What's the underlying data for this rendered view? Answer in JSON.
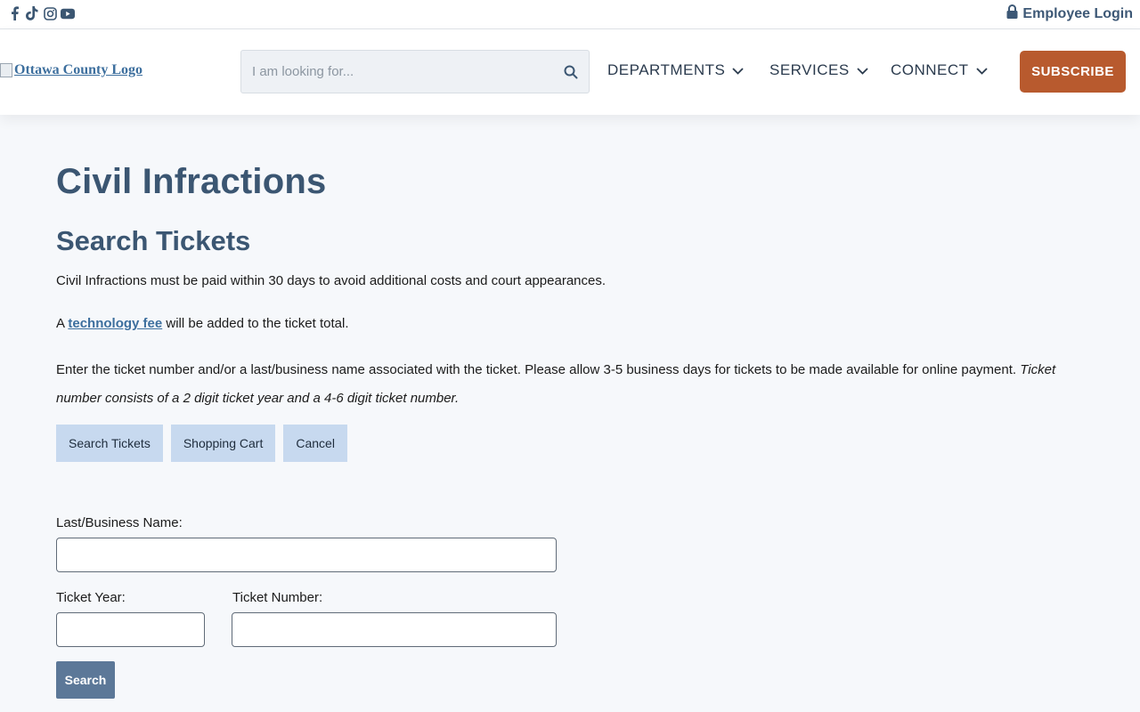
{
  "topbar": {
    "social": [
      {
        "name": "facebook-icon"
      },
      {
        "name": "tiktok-icon"
      },
      {
        "name": "instagram-icon"
      },
      {
        "name": "youtube-icon"
      }
    ],
    "employee_login": "Employee Login"
  },
  "header": {
    "logo_alt": "Ottawa County Logo",
    "search_placeholder": "I am looking for...",
    "nav": [
      {
        "label": "DEPARTMENTS"
      },
      {
        "label": "SERVICES"
      },
      {
        "label": "CONNECT"
      }
    ],
    "subscribe_label": "SUBSCRIBE"
  },
  "main": {
    "title": "Civil Infractions",
    "subtitle": "Search Tickets",
    "para1": "Civil Infractions must be paid within 30 days to avoid additional costs and court appearances.",
    "para2_before": "A ",
    "para2_link": "technology fee",
    "para2_after": " will be added to the ticket total.",
    "para3_text": "Enter the ticket number and/or a last/business name associated with the ticket. Please allow 3-5 business days for tickets to be made available for online payment. ",
    "para3_italic": "Ticket number consists of a 2 digit ticket year and a 4-6 digit ticket number.",
    "buttons": {
      "search_tickets": "Search Tickets",
      "shopping_cart": "Shopping Cart",
      "cancel": "Cancel"
    },
    "form": {
      "last_name_label": "Last/Business Name:",
      "last_name_value": "",
      "ticket_year_label": "Ticket Year:",
      "ticket_year_value": "",
      "ticket_number_label": "Ticket Number:",
      "ticket_number_value": "",
      "search_label": "Search"
    }
  },
  "colors": {
    "heading": "#3b5672",
    "accent_button": "#b85a2e",
    "light_button": "#c7d9ef",
    "primary_button": "#5c7898",
    "link": "#3d6f9e"
  }
}
